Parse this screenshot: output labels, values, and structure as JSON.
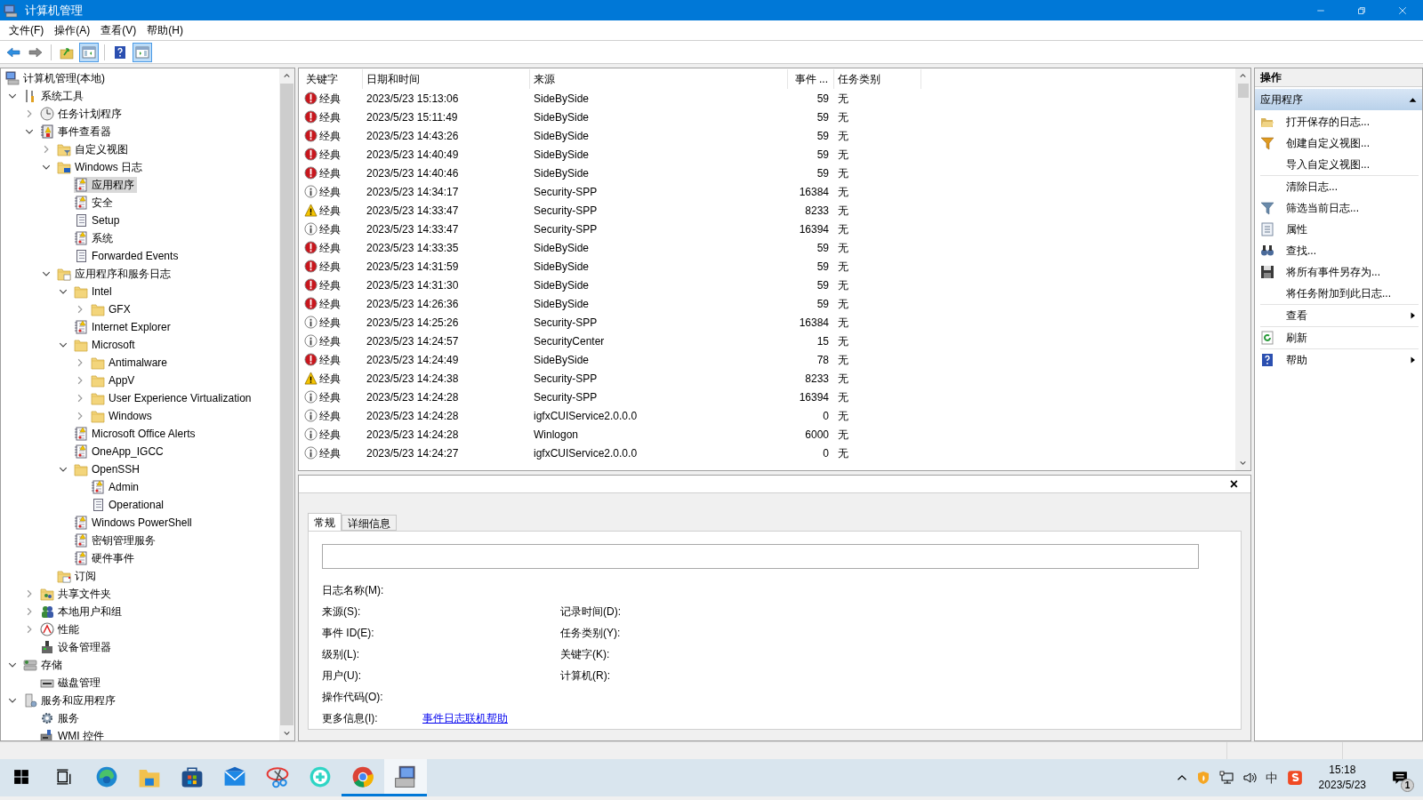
{
  "window": {
    "title": "计算机管理"
  },
  "menu": [
    "文件(F)",
    "操作(A)",
    "查看(V)",
    "帮助(H)"
  ],
  "toolbar": [
    {
      "kind": "back",
      "pressed": false
    },
    {
      "kind": "forward",
      "pressed": false
    },
    {
      "kind": "sep"
    },
    {
      "kind": "up",
      "pressed": false
    },
    {
      "kind": "tree-toggle",
      "pressed": true
    },
    {
      "kind": "sep"
    },
    {
      "kind": "help",
      "pressed": false
    },
    {
      "kind": "actions-toggle",
      "pressed": true
    }
  ],
  "tree": [
    {
      "label": "计算机管理(本地)",
      "kind": "computer",
      "selected": false,
      "children": [
        {
          "label": "系统工具",
          "kind": "tools",
          "selected": false,
          "expanded": true,
          "children": [
            {
              "label": "任务计划程序",
              "kind": "clock",
              "selected": false,
              "expanded": false
            },
            {
              "label": "事件查看器",
              "kind": "viewer",
              "selected": false,
              "expanded": true,
              "children": [
                {
                  "label": "自定义视图",
                  "kind": "folder-filter",
                  "selected": false,
                  "expanded": false
                },
                {
                  "label": "Windows 日志",
                  "kind": "folder-monitor",
                  "selected": false,
                  "expanded": true,
                  "children": [
                    {
                      "label": "应用程序",
                      "kind": "log",
                      "selected": true
                    },
                    {
                      "label": "安全",
                      "kind": "log",
                      "selected": false
                    },
                    {
                      "label": "Setup",
                      "kind": "plain-log",
                      "selected": false
                    },
                    {
                      "label": "系统",
                      "kind": "log",
                      "selected": false
                    },
                    {
                      "label": "Forwarded Events",
                      "kind": "plain-log",
                      "selected": false
                    }
                  ]
                },
                {
                  "label": "应用程序和服务日志",
                  "kind": "folder-doc",
                  "selected": false,
                  "expanded": true,
                  "children": [
                    {
                      "label": "Intel",
                      "kind": "folder",
                      "selected": false,
                      "expanded": true,
                      "children": [
                        {
                          "label": "GFX",
                          "kind": "folder",
                          "selected": false,
                          "expanded": false
                        }
                      ]
                    },
                    {
                      "label": "Internet Explorer",
                      "kind": "log",
                      "selected": false
                    },
                    {
                      "label": "Microsoft",
                      "kind": "folder",
                      "selected": false,
                      "expanded": true,
                      "children": [
                        {
                          "label": "Antimalware",
                          "kind": "folder",
                          "selected": false,
                          "expanded": false
                        },
                        {
                          "label": "AppV",
                          "kind": "folder",
                          "selected": false,
                          "expanded": false
                        },
                        {
                          "label": "User Experience Virtualization",
                          "kind": "folder",
                          "selected": false,
                          "expanded": false
                        },
                        {
                          "label": "Windows",
                          "kind": "folder",
                          "selected": false,
                          "expanded": false
                        }
                      ]
                    },
                    {
                      "label": "Microsoft Office Alerts",
                      "kind": "log",
                      "selected": false
                    },
                    {
                      "label": "OneApp_IGCC",
                      "kind": "log",
                      "selected": false
                    },
                    {
                      "label": "OpenSSH",
                      "kind": "folder",
                      "selected": false,
                      "expanded": true,
                      "children": [
                        {
                          "label": "Admin",
                          "kind": "log",
                          "selected": false
                        },
                        {
                          "label": "Operational",
                          "kind": "plain-log",
                          "selected": false
                        }
                      ]
                    },
                    {
                      "label": "Windows PowerShell",
                      "kind": "log",
                      "selected": false
                    },
                    {
                      "label": "密钥管理服务",
                      "kind": "log",
                      "selected": false
                    },
                    {
                      "label": "硬件事件",
                      "kind": "log",
                      "selected": false
                    }
                  ]
                },
                {
                  "label": "订阅",
                  "kind": "folder-calendar",
                  "selected": false
                }
              ]
            },
            {
              "label": "共享文件夹",
              "kind": "share",
              "selected": false,
              "expanded": false
            },
            {
              "label": "本地用户和组",
              "kind": "users",
              "selected": false,
              "expanded": false
            },
            {
              "label": "性能",
              "kind": "perf",
              "selected": false,
              "expanded": false
            },
            {
              "label": "设备管理器",
              "kind": "device",
              "selected": false
            }
          ]
        },
        {
          "label": "存储",
          "kind": "storage",
          "selected": false,
          "expanded": true,
          "children": [
            {
              "label": "磁盘管理",
              "kind": "disk",
              "selected": false
            }
          ]
        },
        {
          "label": "服务和应用程序",
          "kind": "services",
          "selected": false,
          "expanded": true,
          "children": [
            {
              "label": "服务",
              "kind": "gear",
              "selected": false
            },
            {
              "label": "WMI 控件",
              "kind": "wmi",
              "selected": false
            }
          ]
        }
      ]
    }
  ],
  "table": {
    "columns": [
      "关键字",
      "日期和时间",
      "来源",
      "事件 ...",
      "任务类别"
    ],
    "rows": [
      {
        "kind": "error",
        "keyword": "经典",
        "datetime": "2023/5/23 15:13:06",
        "source": "SideBySide",
        "event_id": "59",
        "category": "无"
      },
      {
        "kind": "error",
        "keyword": "经典",
        "datetime": "2023/5/23 15:11:49",
        "source": "SideBySide",
        "event_id": "59",
        "category": "无"
      },
      {
        "kind": "error",
        "keyword": "经典",
        "datetime": "2023/5/23 14:43:26",
        "source": "SideBySide",
        "event_id": "59",
        "category": "无"
      },
      {
        "kind": "error",
        "keyword": "经典",
        "datetime": "2023/5/23 14:40:49",
        "source": "SideBySide",
        "event_id": "59",
        "category": "无"
      },
      {
        "kind": "error",
        "keyword": "经典",
        "datetime": "2023/5/23 14:40:46",
        "source": "SideBySide",
        "event_id": "59",
        "category": "无"
      },
      {
        "kind": "info",
        "keyword": "经典",
        "datetime": "2023/5/23 14:34:17",
        "source": "Security-SPP",
        "event_id": "16384",
        "category": "无"
      },
      {
        "kind": "warning",
        "keyword": "经典",
        "datetime": "2023/5/23 14:33:47",
        "source": "Security-SPP",
        "event_id": "8233",
        "category": "无"
      },
      {
        "kind": "info",
        "keyword": "经典",
        "datetime": "2023/5/23 14:33:47",
        "source": "Security-SPP",
        "event_id": "16394",
        "category": "无"
      },
      {
        "kind": "error",
        "keyword": "经典",
        "datetime": "2023/5/23 14:33:35",
        "source": "SideBySide",
        "event_id": "59",
        "category": "无"
      },
      {
        "kind": "error",
        "keyword": "经典",
        "datetime": "2023/5/23 14:31:59",
        "source": "SideBySide",
        "event_id": "59",
        "category": "无"
      },
      {
        "kind": "error",
        "keyword": "经典",
        "datetime": "2023/5/23 14:31:30",
        "source": "SideBySide",
        "event_id": "59",
        "category": "无"
      },
      {
        "kind": "error",
        "keyword": "经典",
        "datetime": "2023/5/23 14:26:36",
        "source": "SideBySide",
        "event_id": "59",
        "category": "无"
      },
      {
        "kind": "info",
        "keyword": "经典",
        "datetime": "2023/5/23 14:25:26",
        "source": "Security-SPP",
        "event_id": "16384",
        "category": "无"
      },
      {
        "kind": "info",
        "keyword": "经典",
        "datetime": "2023/5/23 14:24:57",
        "source": "SecurityCenter",
        "event_id": "15",
        "category": "无"
      },
      {
        "kind": "error",
        "keyword": "经典",
        "datetime": "2023/5/23 14:24:49",
        "source": "SideBySide",
        "event_id": "78",
        "category": "无"
      },
      {
        "kind": "warning",
        "keyword": "经典",
        "datetime": "2023/5/23 14:24:38",
        "source": "Security-SPP",
        "event_id": "8233",
        "category": "无"
      },
      {
        "kind": "info",
        "keyword": "经典",
        "datetime": "2023/5/23 14:24:28",
        "source": "Security-SPP",
        "event_id": "16394",
        "category": "无"
      },
      {
        "kind": "info",
        "keyword": "经典",
        "datetime": "2023/5/23 14:24:28",
        "source": "igfxCUIService2.0.0.0",
        "event_id": "0",
        "category": "无"
      },
      {
        "kind": "info",
        "keyword": "经典",
        "datetime": "2023/5/23 14:24:28",
        "source": "Winlogon",
        "event_id": "6000",
        "category": "无"
      },
      {
        "kind": "info",
        "keyword": "经典",
        "datetime": "2023/5/23 14:24:27",
        "source": "igfxCUIService2.0.0.0",
        "event_id": "0",
        "category": "无"
      }
    ]
  },
  "details": {
    "close": "×",
    "tabs": [
      {
        "label": "常规",
        "selected": true
      },
      {
        "label": "详细信息",
        "selected": false
      }
    ],
    "left_fields": [
      "日志名称(M):",
      "来源(S):",
      "事件 ID(E):",
      "级别(L):",
      "用户(U):",
      "操作代码(O):"
    ],
    "right_fields": [
      "记录时间(D):",
      "任务类别(Y):",
      "关键字(K):",
      "计算机(R):"
    ],
    "more_info": {
      "label": "更多信息(I):",
      "link": "事件日志联机帮助"
    }
  },
  "actions": {
    "title": "操作",
    "section": {
      "label": "应用程序",
      "expanded": true
    },
    "groups": [
      [
        {
          "label": "打开保存的日志...",
          "kind": "open",
          "submenu": false
        },
        {
          "label": "创建自定义视图...",
          "kind": "create-filter",
          "submenu": false
        },
        {
          "label": "导入自定义视图...",
          "kind": "plain",
          "submenu": false
        }
      ],
      [
        {
          "label": "清除日志...",
          "kind": "plain",
          "submenu": false
        },
        {
          "label": "筛选当前日志...",
          "kind": "filter",
          "submenu": false
        },
        {
          "label": "属性",
          "kind": "properties",
          "submenu": false
        },
        {
          "label": "查找...",
          "kind": "find",
          "submenu": false
        },
        {
          "label": "将所有事件另存为...",
          "kind": "save",
          "submenu": false
        },
        {
          "label": "将任务附加到此日志...",
          "kind": "plain",
          "submenu": false
        }
      ],
      [
        {
          "label": "查看",
          "kind": "plain",
          "submenu": true
        }
      ],
      [
        {
          "label": "刷新",
          "kind": "refresh",
          "submenu": false
        }
      ],
      [
        {
          "label": "帮助",
          "kind": "help",
          "submenu": true
        }
      ]
    ]
  },
  "taskbar": {
    "apps": [
      {
        "kind": "start",
        "running": false,
        "selected": false
      },
      {
        "kind": "taskview",
        "running": false,
        "selected": false
      },
      {
        "kind": "edge",
        "running": false,
        "selected": false
      },
      {
        "kind": "explorer",
        "running": false,
        "selected": false
      },
      {
        "kind": "store",
        "running": false,
        "selected": false
      },
      {
        "kind": "mail",
        "running": false,
        "selected": false
      },
      {
        "kind": "snip",
        "running": false,
        "selected": false
      },
      {
        "kind": "plus",
        "running": false,
        "selected": false
      },
      {
        "kind": "chrome",
        "running": true,
        "selected": false
      },
      {
        "kind": "compmgmt",
        "running": true,
        "selected": true
      }
    ],
    "ime": "中",
    "time": "15:18",
    "date": "2023/5/23",
    "notifications": "1"
  }
}
